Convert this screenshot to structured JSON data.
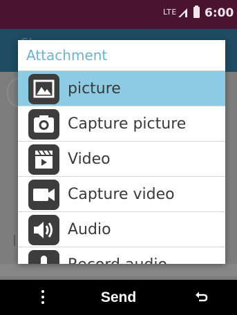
{
  "status_bar": {
    "network": "LTE",
    "time": "6:00",
    "icons": [
      "signal-icon",
      "battery-icon"
    ]
  },
  "background": {
    "header_text": "Share"
  },
  "dialog": {
    "title": "Attachment",
    "items": [
      {
        "label": "picture",
        "icon": "picture-icon",
        "selected": true
      },
      {
        "label": "Capture picture",
        "icon": "camera-icon",
        "selected": false
      },
      {
        "label": "Video",
        "icon": "video-icon",
        "selected": false
      },
      {
        "label": "Capture video",
        "icon": "video-camera-icon",
        "selected": false
      },
      {
        "label": "Audio",
        "icon": "audio-icon",
        "selected": false
      },
      {
        "label": "Record audio",
        "icon": "microphone-icon",
        "selected": false
      }
    ]
  },
  "softkeys": {
    "left_icon": "more-options-icon",
    "center_label": "Send",
    "right_icon": "back-icon"
  },
  "colors": {
    "status_bar": "#4a1330",
    "dialog_title": "#6fb2cf",
    "selected_item": "#8ccbe3",
    "icon_tile": "#3d3d3d"
  }
}
